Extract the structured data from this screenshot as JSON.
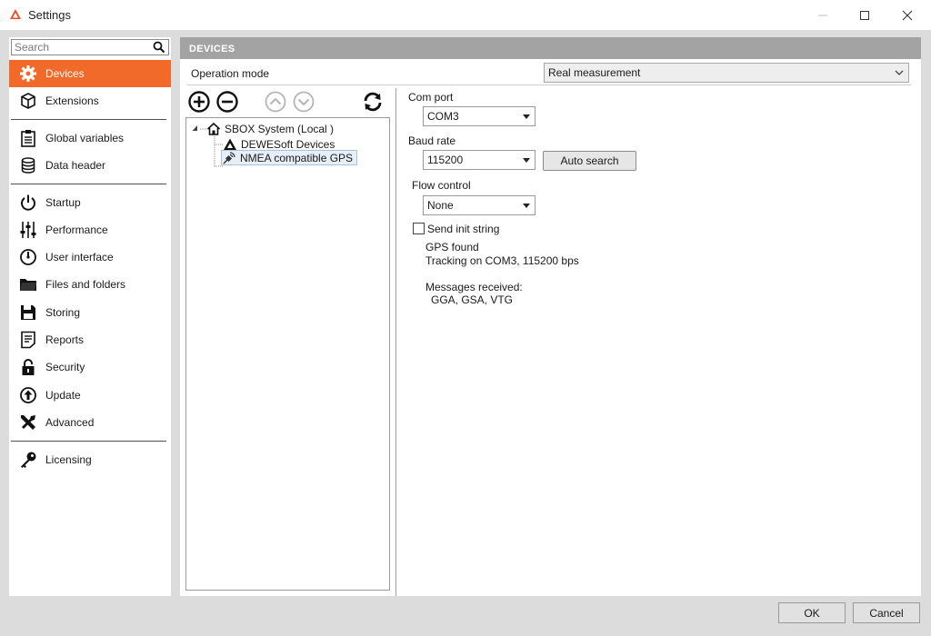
{
  "window": {
    "title": "Settings",
    "brand_color": "#e8502a"
  },
  "sidebar": {
    "search_placeholder": "Search",
    "active_color": "#f26a2a",
    "items": [
      {
        "label": "Devices",
        "icon": "gear-icon"
      },
      {
        "label": "Extensions",
        "icon": "cube-icon"
      },
      {
        "label": "Global variables",
        "icon": "clipboard-icon"
      },
      {
        "label": "Data header",
        "icon": "database-icon"
      },
      {
        "label": "Startup",
        "icon": "power-icon"
      },
      {
        "label": "Performance",
        "icon": "sliders-icon"
      },
      {
        "label": "User interface",
        "icon": "gauge-icon"
      },
      {
        "label": "Files and folders",
        "icon": "folder-icon"
      },
      {
        "label": "Storing",
        "icon": "floppy-icon"
      },
      {
        "label": "Reports",
        "icon": "report-icon"
      },
      {
        "label": "Security",
        "icon": "lock-icon"
      },
      {
        "label": "Update",
        "icon": "update-icon"
      },
      {
        "label": "Advanced",
        "icon": "tools-icon"
      },
      {
        "label": "Licensing",
        "icon": "key-icon"
      }
    ]
  },
  "main": {
    "section_title": "DEVICES",
    "operation_mode": {
      "label": "Operation mode",
      "value": "Real measurement"
    },
    "tree": {
      "root": "SBOX System (Local )",
      "children": [
        "DEWESoft Devices",
        "NMEA compatible GPS"
      ]
    },
    "device": {
      "com_port_label": "Com port",
      "com_port_value": "COM3",
      "baud_rate_label": "Baud rate",
      "baud_rate_value": "115200",
      "auto_search_label": "Auto search",
      "flow_control_label": "Flow control",
      "flow_control_value": "None",
      "send_init_label": "Send init string",
      "send_init_checked": false,
      "status_line1": "GPS found",
      "status_line2": "Tracking on COM3, 115200 bps",
      "messages_label": "Messages received:",
      "messages_value": "GGA, GSA, VTG"
    }
  },
  "footer": {
    "ok_label": "OK",
    "cancel_label": "Cancel"
  }
}
